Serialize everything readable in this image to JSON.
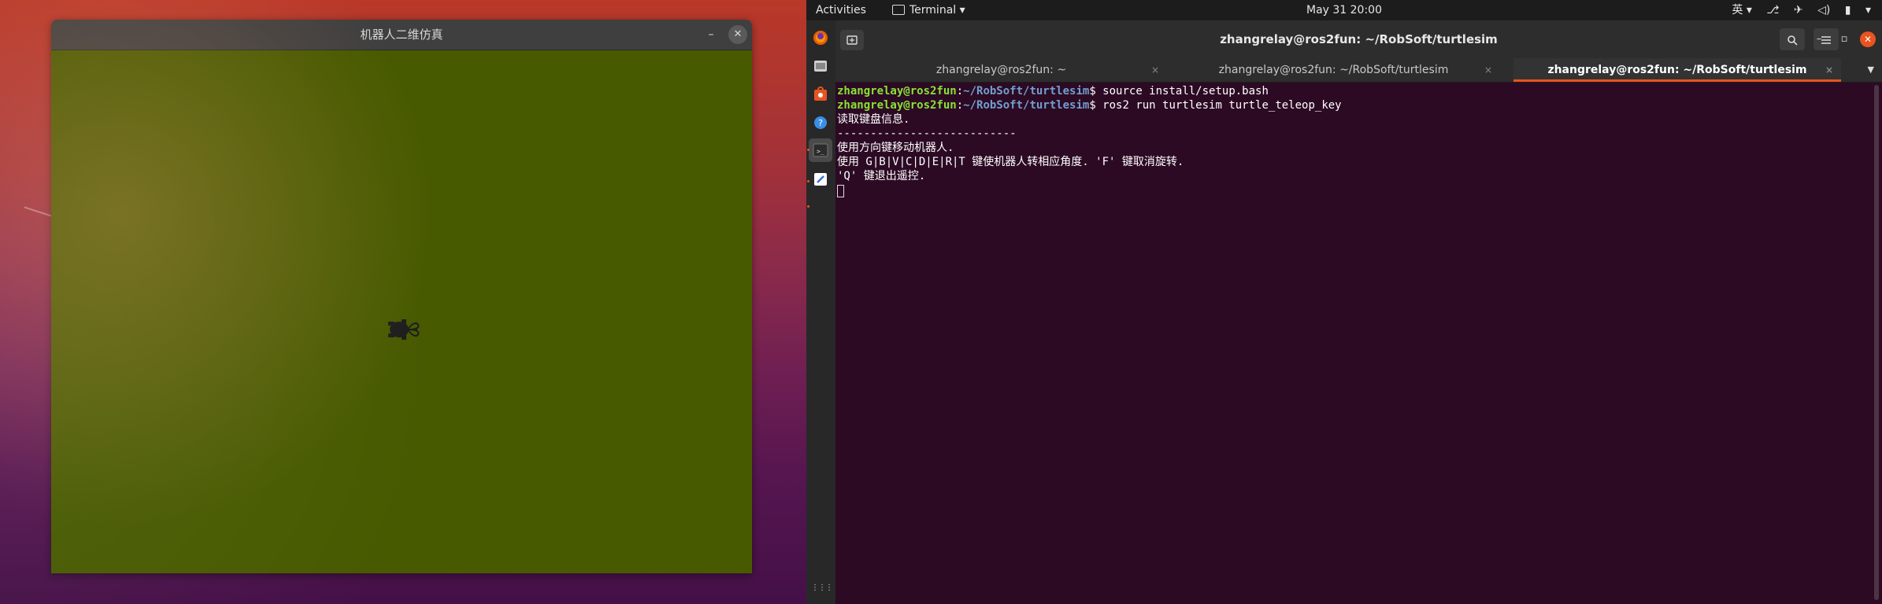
{
  "turtlesim": {
    "title": "机器人二维仿真",
    "bg_color": "#475a00",
    "minimize_label": "–",
    "close_label": "✕"
  },
  "topbar": {
    "activities": "Activities",
    "app_menu": "Terminal",
    "app_menu_arrow": "▾",
    "clock": "May 31  20:00",
    "input_method": "英 ▾",
    "tray_icons": [
      "network-icon",
      "airplane-icon",
      "volume-icon",
      "battery-icon",
      "menu-arrow-icon"
    ]
  },
  "dock": {
    "items": [
      "firefox-icon",
      "files-icon",
      "software-icon",
      "help-icon",
      "terminal-icon",
      "editor-icon"
    ],
    "apps_grid": "⋮⋮⋮"
  },
  "terminal": {
    "window_title": "zhangrelay@ros2fun: ~/RobSoft/turtlesim",
    "new_tab_label": "+",
    "tabs": [
      {
        "label": "zhangrelay@ros2fun: ~",
        "active": false
      },
      {
        "label": "zhangrelay@ros2fun: ~/RobSoft/turtlesim",
        "active": false
      },
      {
        "label": "zhangrelay@ros2fun: ~/RobSoft/turtlesim",
        "active": true
      }
    ],
    "tab_close": "×",
    "lines": [
      {
        "user": "zhangrelay@ros2fun",
        "sep": ":",
        "path": "~/RobSoft/turtlesim",
        "prompt": "$ ",
        "cmd": "source install/setup.bash"
      },
      {
        "user": "zhangrelay@ros2fun",
        "sep": ":",
        "path": "~/RobSoft/turtlesim",
        "prompt": "$ ",
        "cmd": "ros2 run turtlesim turtle_teleop_key"
      }
    ],
    "output": [
      "读取键盘信息.",
      "---------------------------",
      "使用方向键移动机器人.",
      "使用 G|B|V|C|D|E|R|T 键使机器人转相应角度. 'F' 键取消旋转.",
      "'Q' 键退出遥控."
    ],
    "colors": {
      "user": "#8ae234",
      "path": "#729fcf",
      "accent": "#e95420",
      "background": "#2c0a24"
    }
  }
}
